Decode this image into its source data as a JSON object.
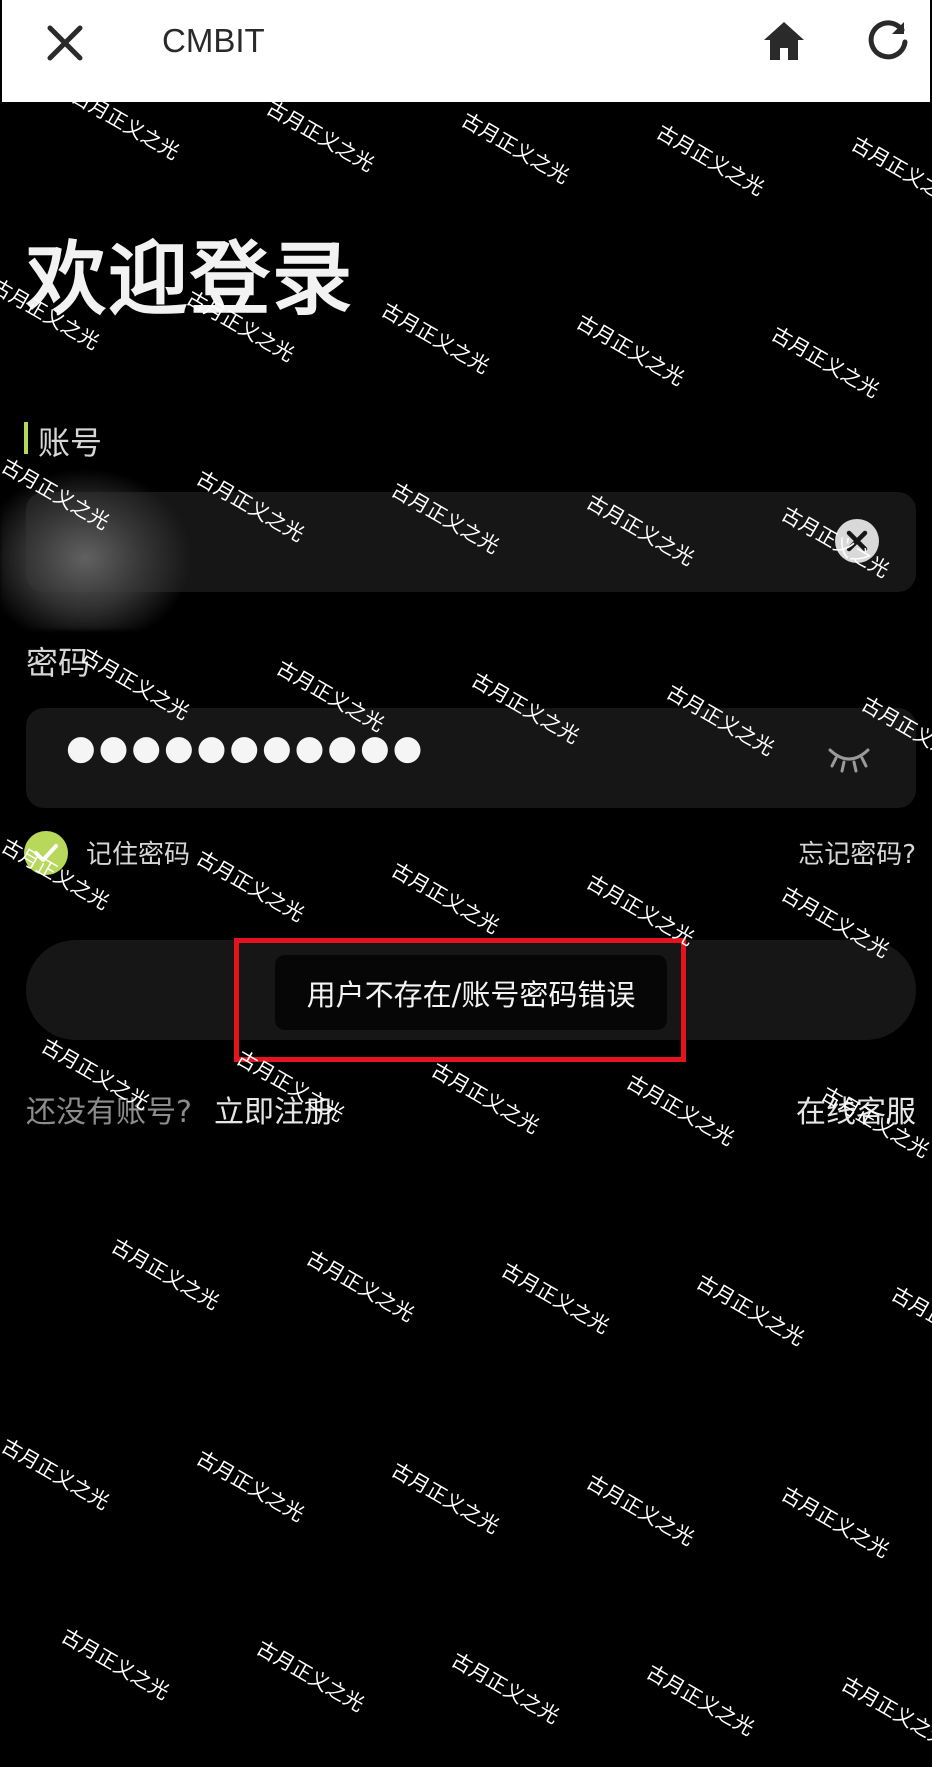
{
  "header": {
    "title": "CMBIT",
    "close_icon": "close-icon",
    "home_icon": "home-icon",
    "refresh_icon": "refresh-icon"
  },
  "login": {
    "heading": "欢迎登录",
    "account_label": "账号",
    "password_label": "密码",
    "password_value": "●●●●●●●●●●●",
    "remember_label": "记住密码",
    "remember_checked": true,
    "forgot_link": "忘记密码?",
    "toast_message": "用户不存在/账号密码错误",
    "no_account_text": "还没有账号?",
    "register_link": "立即注册",
    "support_link": "在线客服"
  },
  "colors": {
    "accent": "#b7d85a",
    "highlight": "#e3141d",
    "background": "#000000",
    "field_bg": "#161616"
  },
  "watermark": {
    "text": "古月正义之光"
  }
}
